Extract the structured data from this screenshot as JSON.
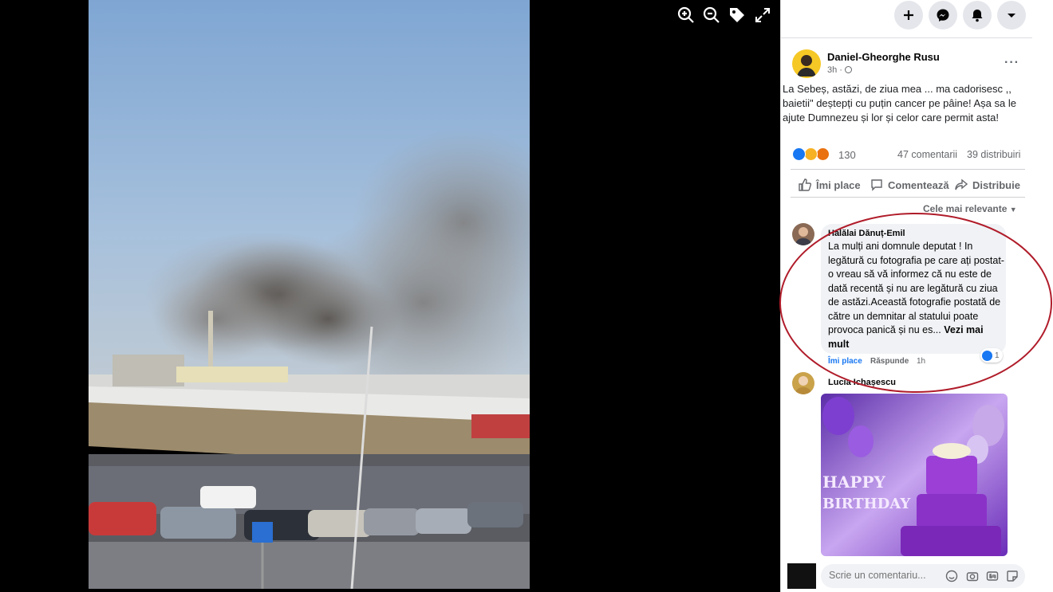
{
  "colors": {
    "accent": "#1877f2",
    "highlight": "#b01c2a",
    "viewer_bg": "#000000"
  },
  "viewer": {
    "tools": [
      "zoom-in-icon",
      "zoom-out-icon",
      "tag-icon",
      "fullscreen-icon"
    ]
  },
  "topbar": {
    "buttons": [
      "plus-icon",
      "messenger-icon",
      "bell-icon",
      "caret-down-icon"
    ]
  },
  "post": {
    "author": "Daniel-Gheorghe Rusu",
    "time": "3h · ",
    "more": "···",
    "text": "La Sebeș, astăzi, de ziua mea ... ma cadorisesc ,, baietii\" deștepți cu puțin cancer pe pâine! Așa sa le ajute Dumnezeu și lor și celor care permit asta!",
    "reaction_count": "130",
    "comments_count": "47 comentarii",
    "shares_count": "39 distribuiri",
    "actions": {
      "like": "Îmi place",
      "comment": "Comentează",
      "share": "Distribuie"
    },
    "sort_label": "Cele mai relevante"
  },
  "comments": [
    {
      "name": "Halălai Dănuț-Emil",
      "text": "La mulți ani domnule deputat ! In legătură cu fotografia pe care ați postat-o vreau să vă informez că nu este de dată recentă și nu are legătură cu ziua de astăzi.Această fotografie postată de către un demnitar al statului poate provoca panică și nu es... ",
      "see_more": "Vezi mai mult",
      "like": "Îmi place",
      "reply": "Răspunde",
      "time": "1h",
      "reactions": "1"
    },
    {
      "name": "Lucia Ichașescu",
      "image_text": "HAPPY BIRTHDAY"
    }
  ],
  "composer": {
    "placeholder": "Scrie un comentariu..."
  }
}
